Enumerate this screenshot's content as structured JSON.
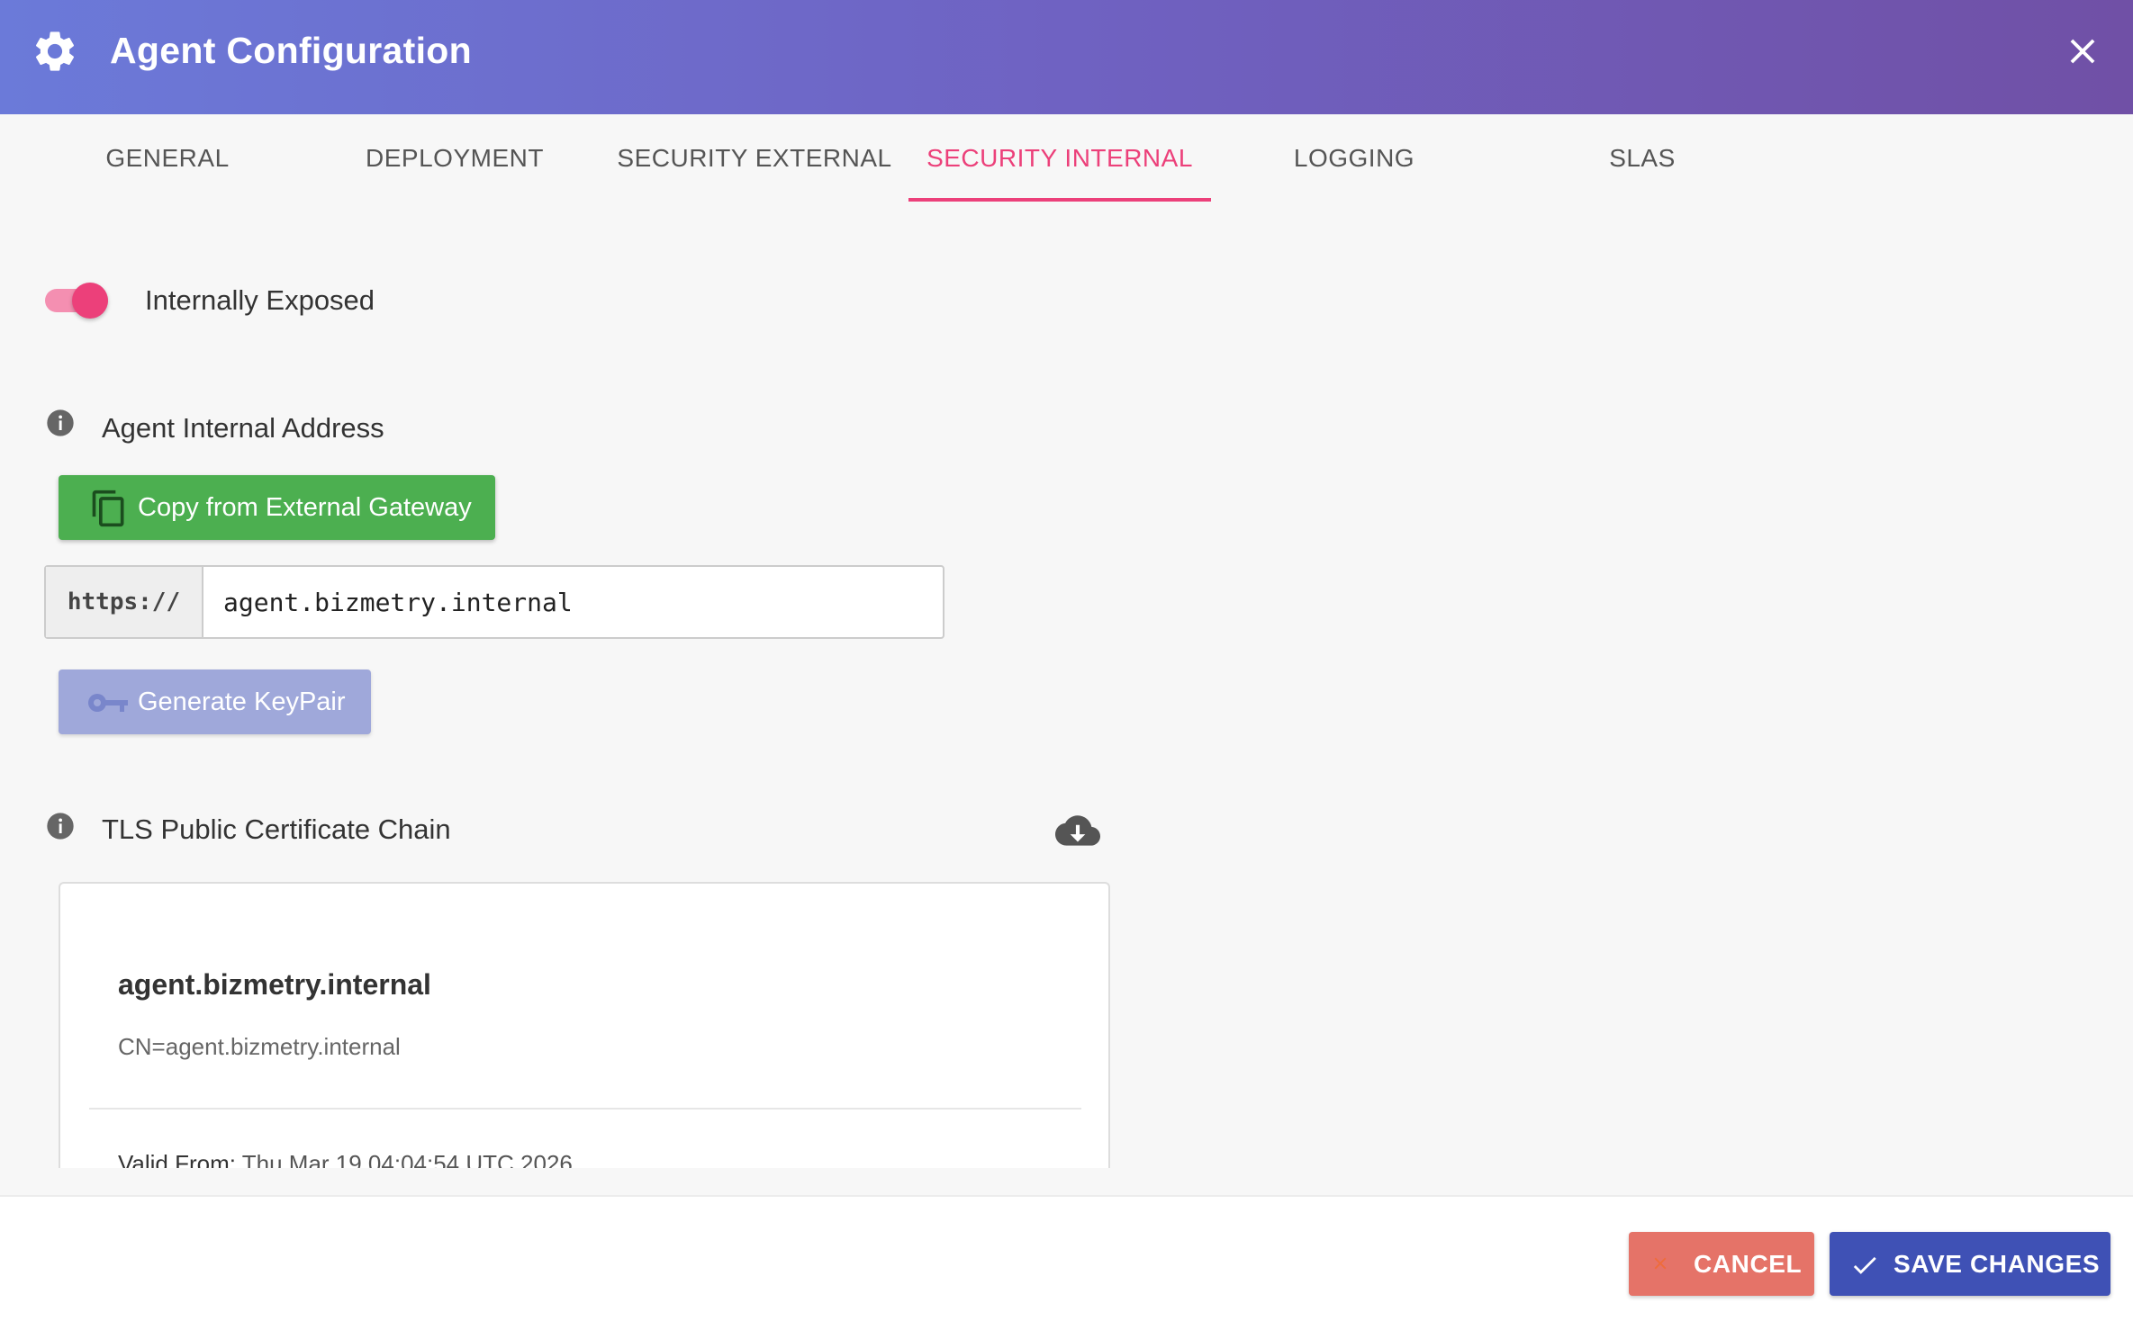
{
  "header": {
    "title": "Agent Configuration",
    "icon": "gear-icon",
    "close_icon": "close-icon"
  },
  "tabs": [
    {
      "label": "GENERAL",
      "active": false
    },
    {
      "label": "DEPLOYMENT",
      "active": false
    },
    {
      "label": "SECURITY EXTERNAL",
      "active": false
    },
    {
      "label": "SECURITY INTERNAL",
      "active": true
    },
    {
      "label": "LOGGING",
      "active": false
    },
    {
      "label": "SLAS",
      "active": false
    }
  ],
  "internal_exposure": {
    "label": "Internally Exposed",
    "enabled": true
  },
  "address": {
    "label": "Agent Internal Address",
    "copy_button": "Copy from External Gateway",
    "scheme": "https://",
    "value": "agent.bizmetry.internal"
  },
  "keypair": {
    "button": "Generate KeyPair",
    "disabled": true
  },
  "certificate": {
    "label": "TLS Public Certificate Chain",
    "name": "agent.bizmetry.internal",
    "subject": "CN=agent.bizmetry.internal",
    "valid_from_label": "Valid From:",
    "valid_from": "Thu Mar 19 04:04:54 UTC 2026"
  },
  "footer": {
    "cancel": "CANCEL",
    "save": "SAVE CHANGES"
  },
  "colors": {
    "header_start": "#6b7ad9",
    "header_end": "#7050a6",
    "accent_pink": "#ec407a",
    "copy_green": "#4caf50",
    "keypair_disabled": "#9fa8da",
    "cancel_red": "#e57368",
    "save_blue": "#3f51b5"
  }
}
